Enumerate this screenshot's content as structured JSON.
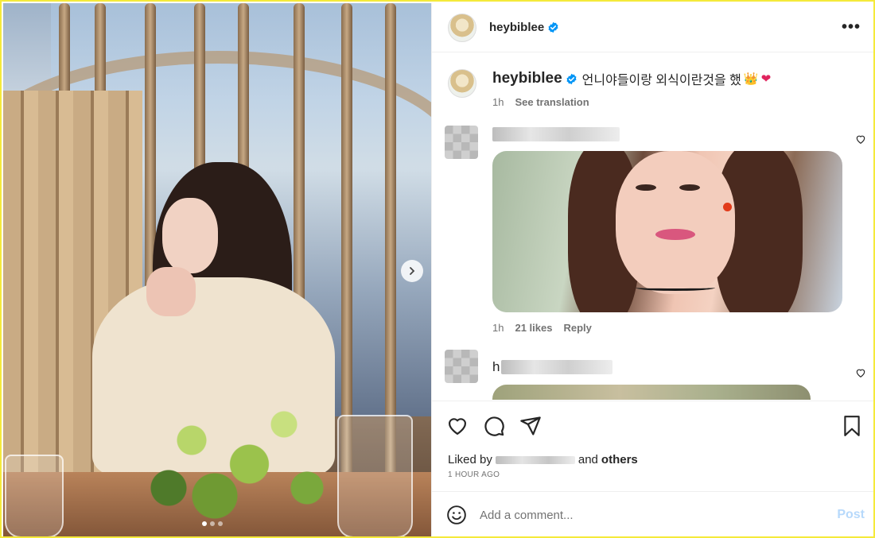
{
  "post": {
    "username": "heybiblee",
    "caption": "언니야들이랑 외식이란것을 했",
    "caption_emojis": [
      "👑",
      "❤"
    ],
    "time": "1h",
    "see_translation": "See translation"
  },
  "comments": [
    {
      "time": "1h",
      "likes": "21 likes",
      "reply": "Reply"
    },
    {
      "name_fragment": "h"
    }
  ],
  "likes": {
    "prefix": "Liked by",
    "and": "and",
    "others": "others"
  },
  "timestamp": "1 HOUR AGO",
  "add_comment": {
    "placeholder": "Add a comment...",
    "post_label": "Post"
  },
  "colors": {
    "verified": "#0095f6",
    "post_disabled": "#b7d9fb"
  },
  "icons": [
    "more-options-icon",
    "heart-icon",
    "comment-icon",
    "share-icon",
    "bookmark-icon",
    "emoji-icon",
    "verified-badge-icon",
    "chevron-right-icon"
  ]
}
